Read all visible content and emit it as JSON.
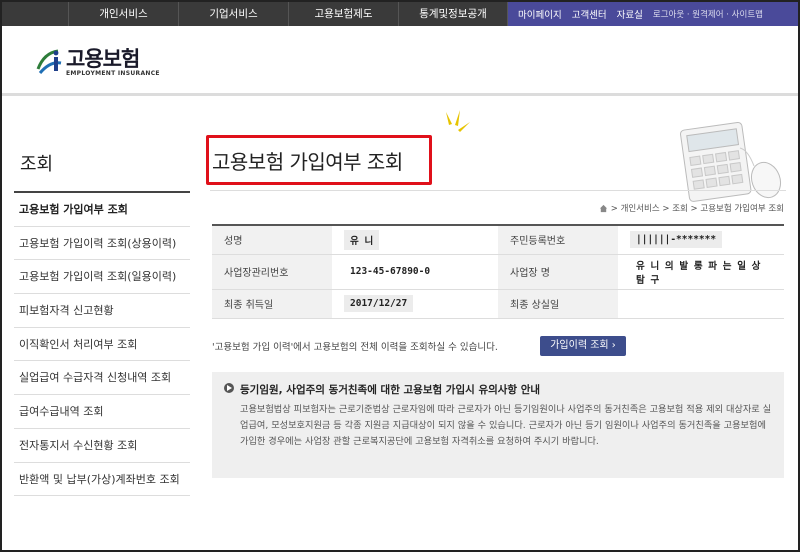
{
  "nav": {
    "main": [
      "개인서비스",
      "기업서비스",
      "고용보험제도",
      "통계및정보공개"
    ],
    "sub": [
      "마이페이지",
      "고객센터",
      "자료실"
    ],
    "util": "로그아웃 · 원격제어 · 사이트맵"
  },
  "logo": {
    "kr": "고용보험",
    "en": "EMPLOYMENT INSURANCE",
    "icon": "employment-insurance-logo"
  },
  "sidebar": {
    "title": "조회",
    "items": [
      "고용보험 가입여부 조회",
      "고용보험 가입이력 조회(상용이력)",
      "고용보험 가입이력 조회(일용이력)",
      "피보험자격 신고현황",
      "이직확인서 처리여부 조회",
      "실업급여 수급자격 신청내역 조회",
      "급여수급내역 조회",
      "전자통지서 수신현황 조회",
      "반환액 및 납부(가상)계좌번호 조회"
    ]
  },
  "page": {
    "title": "고용보험 가입여부 조회",
    "breadcrumb": "> 개인서비스 > 조회 > 고용보험 가입여부 조회"
  },
  "info": {
    "name_label": "성명",
    "name_value": "유 니",
    "rrn_label": "주민등록번호",
    "rrn_value": "||||||-*******",
    "bizno_label": "사업장관리번호",
    "bizno_value": "123-45-67890-0",
    "bizname_label": "사업장 명",
    "bizname_value": "유 니 의 발 롱 파 는 일 상 탐 구",
    "acq_label": "최종 취득일",
    "acq_value": "2017/12/27",
    "loss_label": "최종 상실일",
    "loss_value": ""
  },
  "note": "'고용보험 가입 이력'에서 고용보험의 전체 이력을 조회하실 수 있습니다.",
  "history_button": "가입이력 조회 ›",
  "notice": {
    "title": "등기임원, 사업주의 동거친족에 대한 고용보험 가입시 유의사항 안내",
    "body": "고용보험법상 피보험자는 근로기준법상 근로자임에 따라 근로자가 아닌 등기임원이나 사업주의 동거친족은 고용보험 적용 제외 대상자로 실업급여, 모성보호지원금 등 각종 지원금 지급대상이 되지 않을 수 있습니다. 근로자가 아닌 등기 임원이나 사업주의 동거친족을 고용보험에 가입한 경우에는 사업장 관할 근로복지공단에 고용보험 자격취소를 요청하여 주시기 바랍니다."
  },
  "colors": {
    "highlight_box": "#e0101a",
    "button": "#3d4d8c",
    "nav_sub": "#4a4a9a",
    "topbar": "#3a3a3a"
  }
}
